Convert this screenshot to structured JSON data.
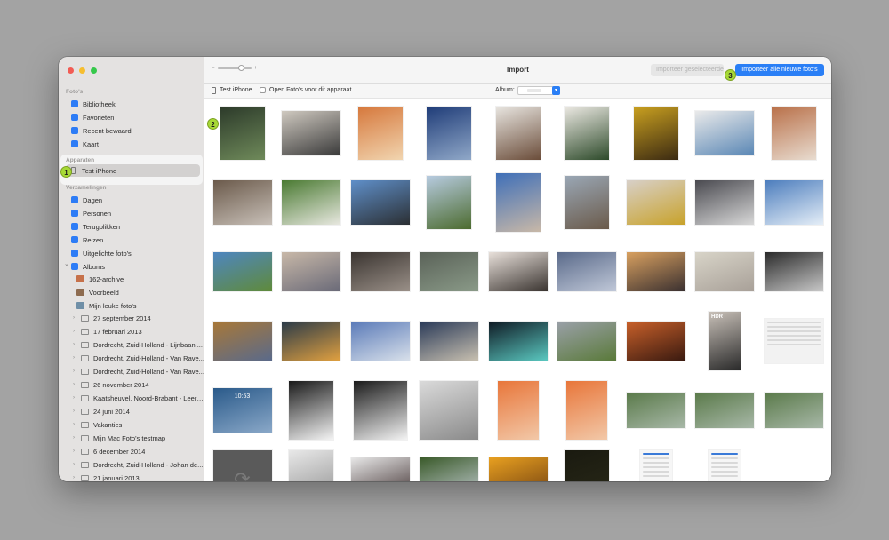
{
  "window": {
    "title": "Import",
    "traffic_colors": [
      "#f25c54",
      "#f6be2f",
      "#35c84a"
    ]
  },
  "sidebar": {
    "sections": {
      "photos": "Foto's",
      "devices": "Apparaten",
      "collections": "Verzamelingen"
    },
    "library_items": [
      {
        "label": "Bibliotheek",
        "icon": "photo-library-icon"
      },
      {
        "label": "Favorieten",
        "icon": "heart-icon"
      },
      {
        "label": "Recent bewaard",
        "icon": "clock-icon"
      },
      {
        "label": "Kaart",
        "icon": "map-icon"
      }
    ],
    "device": {
      "label": "Test iPhone",
      "icon": "iphone-icon",
      "selected": true
    },
    "collection_items": [
      {
        "label": "Dagen",
        "icon": "calendar-icon"
      },
      {
        "label": "Personen",
        "icon": "person-icon"
      },
      {
        "label": "Terugblikken",
        "icon": "memories-icon"
      },
      {
        "label": "Reizen",
        "icon": "trips-icon"
      },
      {
        "label": "Uitgelichte foto's",
        "icon": "featured-icon"
      },
      {
        "label": "Albums",
        "icon": "albums-icon"
      }
    ],
    "album_items": [
      {
        "label": "162-archive",
        "color": "#c6714a"
      },
      {
        "label": "Voorbeeld",
        "color": "#8d6b4f"
      },
      {
        "label": "Mijn leuke foto's",
        "color": "#6f8fa7"
      }
    ],
    "folder_items": [
      "27 september 2014",
      "17 februari 2013",
      "Dordrecht, Zuid-Holland - Lijnbaan,...",
      "Dordrecht, Zuid-Holland - Van Rave...",
      "Dordrecht, Zuid-Holland - Van Rave...",
      "26 november 2014",
      "Kaatsheuvel, Noord-Brabant - Leers...",
      "24 juni 2014",
      "Vakanties",
      "Mijn Mac Foto's testmap",
      "6 december 2014",
      "Dordrecht, Zuid-Holland - Johan de...",
      "21 januari 2013"
    ]
  },
  "toolbar": {
    "zoom_minus": "−",
    "zoom_plus": "+",
    "zoom_level": 0.7,
    "import_selected_label": "Importeer geselecteerde",
    "import_all_label": "Importeer alle nieuwe foto's"
  },
  "subbar": {
    "device_label": "Test iPhone",
    "open_photos_label": "Open Foto's voor dit apparaat",
    "open_photos_checked": false,
    "album_label": "Album:"
  },
  "badges": [
    "1",
    "2",
    "3"
  ],
  "photo_grid": {
    "rows": [
      [
        {
          "w": 50,
          "h": 60,
          "colors": [
            "#2c3a2a",
            "#6f8a5a"
          ]
        },
        {
          "w": 66,
          "h": 50,
          "colors": [
            "#cfc9c0",
            "#3a3a3a"
          ]
        },
        {
          "w": 50,
          "h": 60,
          "colors": [
            "#d6783c",
            "#f1d5b0"
          ]
        },
        {
          "w": 50,
          "h": 60,
          "colors": [
            "#1f3c78",
            "#90a8c8"
          ]
        },
        {
          "w": 50,
          "h": 60,
          "colors": [
            "#e8e5e0",
            "#6b4d3a"
          ]
        },
        {
          "w": 50,
          "h": 60,
          "colors": [
            "#ece9e3",
            "#2d4a2a"
          ]
        },
        {
          "w": 50,
          "h": 60,
          "colors": [
            "#c9a020",
            "#3b2a12"
          ]
        },
        {
          "w": 66,
          "h": 50,
          "colors": [
            "#eaeaea",
            "#5a87b5"
          ]
        },
        {
          "w": 50,
          "h": 60,
          "colors": [
            "#b97049",
            "#e8dcd0"
          ]
        }
      ],
      [
        {
          "w": 66,
          "h": 50,
          "colors": [
            "#6b5a4b",
            "#c8c0b8"
          ]
        },
        {
          "w": 66,
          "h": 50,
          "colors": [
            "#4a7a32",
            "#e8e8e0"
          ]
        },
        {
          "w": 66,
          "h": 50,
          "colors": [
            "#5f8fc9",
            "#2b2f33"
          ]
        },
        {
          "w": 50,
          "h": 60,
          "colors": [
            "#b7cbe0",
            "#4c6b2f"
          ]
        },
        {
          "w": 50,
          "h": 66,
          "colors": [
            "#3f6fb8",
            "#c8b8a8"
          ]
        },
        {
          "w": 50,
          "h": 60,
          "colors": [
            "#9aa7b5",
            "#6a5a4a"
          ]
        },
        {
          "w": 66,
          "h": 50,
          "colors": [
            "#d8d0c8",
            "#c8a22a"
          ]
        },
        {
          "w": 66,
          "h": 50,
          "colors": [
            "#4a4a50",
            "#d8d8d8"
          ]
        },
        {
          "w": 66,
          "h": 50,
          "colors": [
            "#4c7dbd",
            "#e5eef7"
          ]
        }
      ],
      [
        {
          "w": 66,
          "h": 44,
          "colors": [
            "#4e86c0",
            "#5f8a3a"
          ]
        },
        {
          "w": 66,
          "h": 44,
          "colors": [
            "#c8b8a8",
            "#6a6a78"
          ]
        },
        {
          "w": 66,
          "h": 44,
          "colors": [
            "#3a3430",
            "#9a9088"
          ]
        },
        {
          "w": 66,
          "h": 44,
          "colors": [
            "#5a6258",
            "#8a9a88"
          ]
        },
        {
          "w": 66,
          "h": 44,
          "colors": [
            "#e8e0da",
            "#3a3430"
          ]
        },
        {
          "w": 66,
          "h": 44,
          "colors": [
            "#5a6a8a",
            "#c0c8d8"
          ]
        },
        {
          "w": 66,
          "h": 44,
          "colors": [
            "#d8a060",
            "#3a3030"
          ]
        },
        {
          "w": 66,
          "h": 44,
          "colors": [
            "#d8d4c8",
            "#a8a098"
          ]
        },
        {
          "w": 66,
          "h": 44,
          "colors": [
            "#2a2a2a",
            "#c8c8c8"
          ]
        }
      ],
      [
        {
          "w": 66,
          "h": 44,
          "colors": [
            "#a87838",
            "#5a6a8a"
          ]
        },
        {
          "w": 66,
          "h": 44,
          "colors": [
            "#2a3a48",
            "#e0a040"
          ]
        },
        {
          "w": 66,
          "h": 44,
          "colors": [
            "#5a7ab8",
            "#d8e0ea"
          ]
        },
        {
          "w": 66,
          "h": 44,
          "colors": [
            "#2a3a58",
            "#c8c0b0"
          ]
        },
        {
          "w": 66,
          "h": 44,
          "colors": [
            "#0f1a24",
            "#5ac8c0"
          ]
        },
        {
          "w": 66,
          "h": 44,
          "colors": [
            "#9aa0a8",
            "#5a7a3a"
          ]
        },
        {
          "w": 66,
          "h": 44,
          "colors": [
            "#c8602a",
            "#3a1a10"
          ]
        },
        {
          "w": 36,
          "h": 66,
          "colors": [
            "#c8c0b8",
            "#2a2a2a"
          ],
          "label": "HDR"
        },
        {
          "w": 66,
          "h": 50,
          "colors": [
            "#f2f2f2",
            "#d8d8d8"
          ],
          "screenshot": true
        }
      ],
      [
        {
          "w": 66,
          "h": 50,
          "colors": [
            "#2a5a8a",
            "#8aa8c8"
          ],
          "lock": "10:53"
        },
        {
          "w": 50,
          "h": 66,
          "colors": [
            "#1a1a1a",
            "#f4f4f4"
          ]
        },
        {
          "w": 60,
          "h": 66,
          "colors": [
            "#1a1a1a",
            "#f4f4f4"
          ]
        },
        {
          "w": 66,
          "h": 66,
          "colors": [
            "#dadada",
            "#8a8a8a"
          ]
        },
        {
          "w": 46,
          "h": 66,
          "colors": [
            "#e8763a",
            "#f2c8a8"
          ]
        },
        {
          "w": 46,
          "h": 66,
          "colors": [
            "#e8763a",
            "#f2c8a8"
          ]
        },
        {
          "w": 66,
          "h": 40,
          "colors": [
            "#5a7a4a",
            "#a8b8a8"
          ]
        },
        {
          "w": 66,
          "h": 40,
          "colors": [
            "#5a7a4a",
            "#a8b8a8"
          ]
        },
        {
          "w": 66,
          "h": 40,
          "colors": [
            "#5a7a4a",
            "#a8b8a8"
          ]
        }
      ],
      [
        {
          "w": 66,
          "h": 66,
          "colors": [
            "#5a5a5a",
            "#7a7a7a"
          ],
          "placeholder": true
        },
        {
          "w": 50,
          "h": 66,
          "colors": [
            "#e8e8e8",
            "#8a8a8a"
          ]
        },
        {
          "w": 66,
          "h": 50,
          "colors": [
            "#e8e8e8",
            "#3a2a2a"
          ]
        },
        {
          "w": 66,
          "h": 50,
          "colors": [
            "#3a5a2a",
            "#c8d0d8"
          ]
        },
        {
          "w": 66,
          "h": 50,
          "colors": [
            "#e8a020",
            "#6a3a10"
          ]
        },
        {
          "w": 50,
          "h": 66,
          "colors": [
            "#1a1a10",
            "#2a2a18"
          ]
        },
        {
          "w": 36,
          "h": 66,
          "colors": [
            "#f6f6f6",
            "#3a7ad8"
          ],
          "screenshot": true
        },
        {
          "w": 36,
          "h": 66,
          "colors": [
            "#f6f6f6",
            "#3a7ad8"
          ],
          "screenshot": true
        }
      ]
    ]
  }
}
